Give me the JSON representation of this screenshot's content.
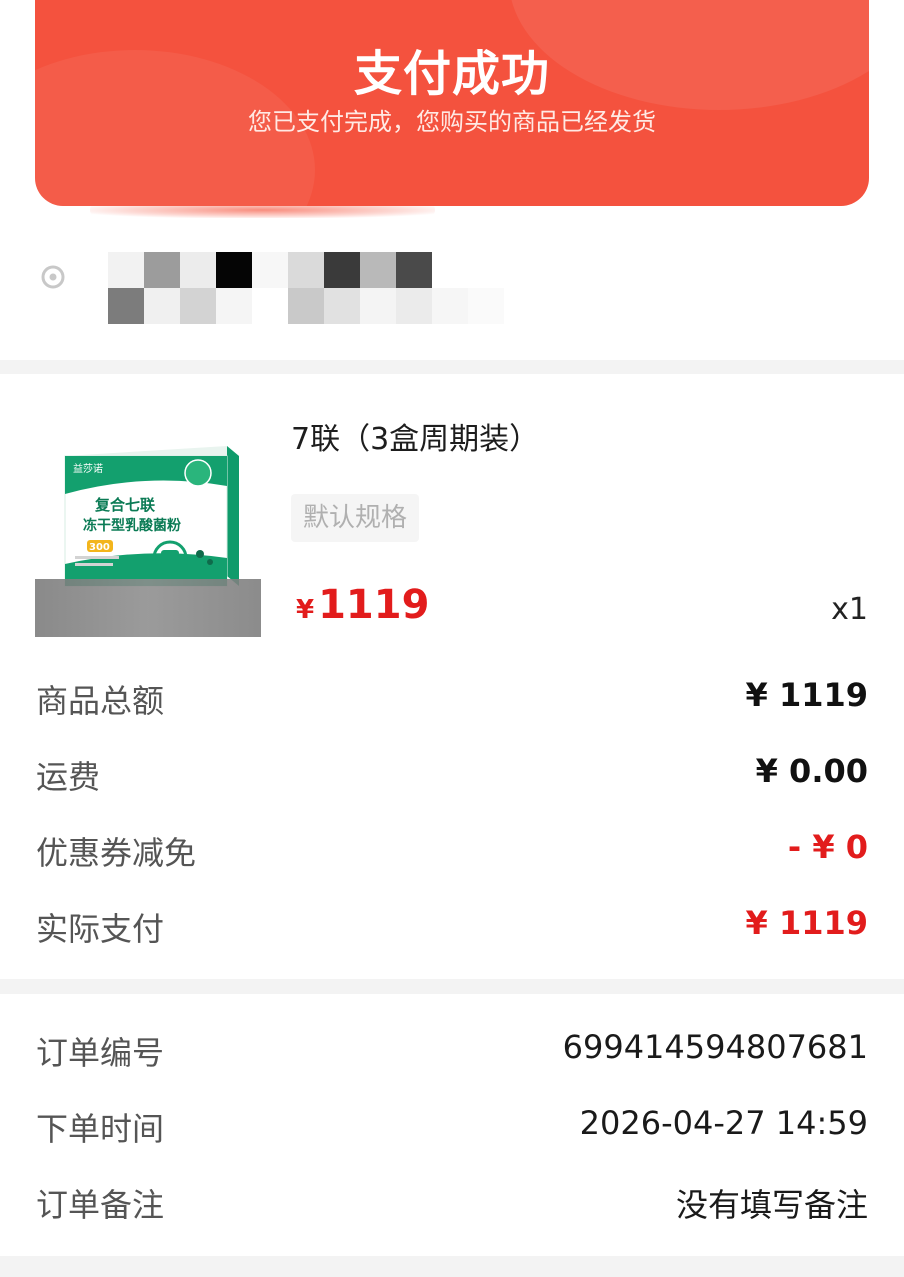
{
  "banner": {
    "title": "支付成功",
    "subtitle": "您已支付完成，您购买的商品已经发货"
  },
  "address": {
    "icon": "location-pin-icon",
    "redacted": true
  },
  "product": {
    "name": "7联（3盒周期装）",
    "spec": "默认规格",
    "currency_symbol": "¥",
    "price": "1119",
    "quantity": "x1",
    "image_alt": "复合七联冻干型乳酸菌粉"
  },
  "summary": {
    "goods_total_label": "商品总额",
    "goods_total_value": "¥ 1119",
    "shipping_label": "运费",
    "shipping_value": "¥ 0.00",
    "coupon_label": "优惠券减免",
    "coupon_value": "- ¥ 0",
    "paid_label": "实际支付",
    "paid_value": "¥ 1119"
  },
  "order": {
    "number_label": "订单编号",
    "number_value": "699414594807681",
    "time_label": "下单时间",
    "time_value": "2026-04-27 14:59",
    "note_label": "订单备注",
    "note_value": "没有填写备注"
  },
  "colors": {
    "banner": "#f4523e",
    "price_red": "#e21c1c",
    "spec_bg": "#f5f5f5"
  }
}
